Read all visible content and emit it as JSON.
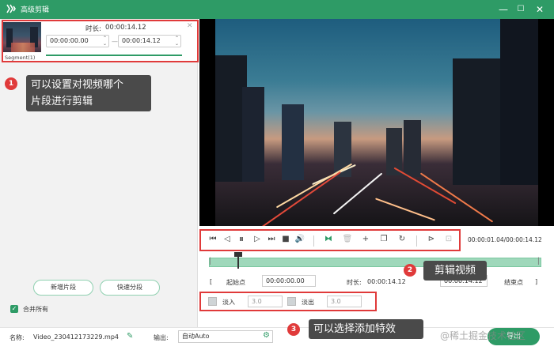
{
  "window": {
    "title": "高级剪辑",
    "min": "—",
    "max": "☐",
    "close": "✕"
  },
  "segment": {
    "duration_label": "时长:",
    "duration_value": "00:00:14.12",
    "start": "00:00:00.00",
    "end": "00:00:14.12",
    "dash": "—",
    "name": "Segment(1)",
    "close": "✕"
  },
  "annotations": [
    {
      "num": "1",
      "text": "可以设置对视频哪个\n片段进行剪辑"
    },
    {
      "num": "2",
      "text": "剪辑视频"
    },
    {
      "num": "3",
      "text": "可以选择添加特效"
    }
  ],
  "left_buttons": {
    "new_segment": "新增片段",
    "quick_split": "快速分段"
  },
  "merge_all": {
    "label": "合并所有",
    "checked": true
  },
  "player": {
    "time_readout": "00:00:01.04/00:00:14.12"
  },
  "range": {
    "start_label": "起始点",
    "start_value": "00:00:00.00",
    "duration_label": "时长:",
    "duration_value": "00:00:14.12",
    "end_value": "00:00:14.12",
    "end_label": "结束点",
    "left_bracket": "[",
    "right_bracket": "]"
  },
  "effects": {
    "fade_in": "淡入",
    "fade_in_value": "3.0",
    "fade_out": "淡出",
    "fade_out_value": "3.0"
  },
  "bottom": {
    "name_label": "名称:",
    "file_name": "Video_230412173229.mp4",
    "output_label": "输出:",
    "output_value": "自动Auto",
    "export": "导出",
    "watermark": "@稀土掘金技术社区"
  },
  "colors": {
    "brand": "#2e9b66",
    "annotation": "#e03a3a"
  }
}
